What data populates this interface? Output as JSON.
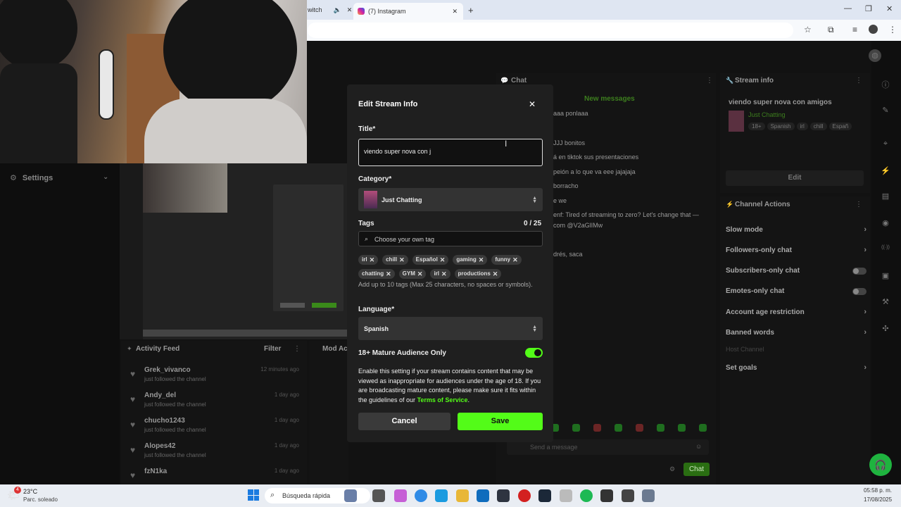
{
  "browser": {
    "tab1_label": "witch",
    "tab2_label": "(7) Instagram",
    "new_tab": "+",
    "minimize": "—",
    "restore": "❐",
    "close": "✕"
  },
  "sidebar": {
    "settings_label": "Settings"
  },
  "activity_feed": {
    "title": "Activity Feed",
    "filter_label": "Filter",
    "mod_label": "Mod Ac",
    "items": [
      {
        "name": "Grek_vivanco",
        "action": "just followed the channel",
        "time": "12 minutes ago"
      },
      {
        "name": "Andy_del",
        "action": "just followed the channel",
        "time": "1 day ago"
      },
      {
        "name": "chucho1243",
        "action": "just followed the channel",
        "time": "1 day ago"
      },
      {
        "name": "Alopes42",
        "action": "just followed the channel",
        "time": "1 day ago"
      },
      {
        "name": "fzN1ka",
        "action": "",
        "time": "1 day ago"
      }
    ]
  },
  "chat": {
    "title": "Chat",
    "new_messages": "New messages",
    "lines": [
      "aaa ponlaaa",
      "JJJ bonitos",
      "á en tiktok sus presentaciones",
      "peión a lo que va eee jajajaja",
      "borracho",
      "e we",
      "enf: Tired of streaming to zero? Let's change that —",
      "com @V2aGlIMw",
      "drés, saca"
    ],
    "send_placeholder": "Send a message",
    "chat_button": "Chat"
  },
  "stream_info": {
    "title": "Stream info",
    "stream_title": "viendo super nova con amigos",
    "category": "Just Chatting",
    "tags": [
      "18+",
      "Spanish",
      "irl",
      "chill",
      "Españ"
    ],
    "edit_label": "Edit"
  },
  "channel_actions": {
    "title": "Channel Actions",
    "items": [
      "Slow mode",
      "Followers-only chat",
      "Subscribers-only chat",
      "Emotes-only chat",
      "Account age restriction",
      "Banned words",
      "Host Channel",
      "Set goals"
    ]
  },
  "modal": {
    "title": "Edit Stream Info",
    "title_label": "Title*",
    "title_value": "viendo super nova con j",
    "category_label": "Category*",
    "category_value": "Just Chatting",
    "tags_label": "Tags",
    "tags_count": "0 / 25",
    "tag_placeholder": "Choose your own tag",
    "tags": [
      "irl",
      "chill",
      "Español",
      "gaming",
      "funny",
      "chatting",
      "GYM",
      "irl",
      "productions"
    ],
    "tags_help": "Add up to 10 tags (Max 25 characters, no spaces or symbols).",
    "language_label": "Language*",
    "language_value": "Spanish",
    "mature_label": "18+ Mature Audience Only",
    "mature_on": true,
    "mature_desc": "Enable this setting if your stream contains content that may be viewed as inappropriate for audiences under the age of 18. If you are broadcasting mature content, please make sure it fits within the guidelines of our",
    "terms_link": "Terms of Service",
    "cancel_label": "Cancel",
    "save_label": "Save"
  },
  "taskbar": {
    "weather_temp": "23°C",
    "weather_desc": "Parc. soleado",
    "weather_badge": "4",
    "search_label": "Búsqueda rápida",
    "time": "05:58 p. m.",
    "date": "17/08/2025"
  },
  "colors": {
    "accent": "#53fc18",
    "modal_bg": "#1f1f1f",
    "field_bg": "#333333"
  }
}
